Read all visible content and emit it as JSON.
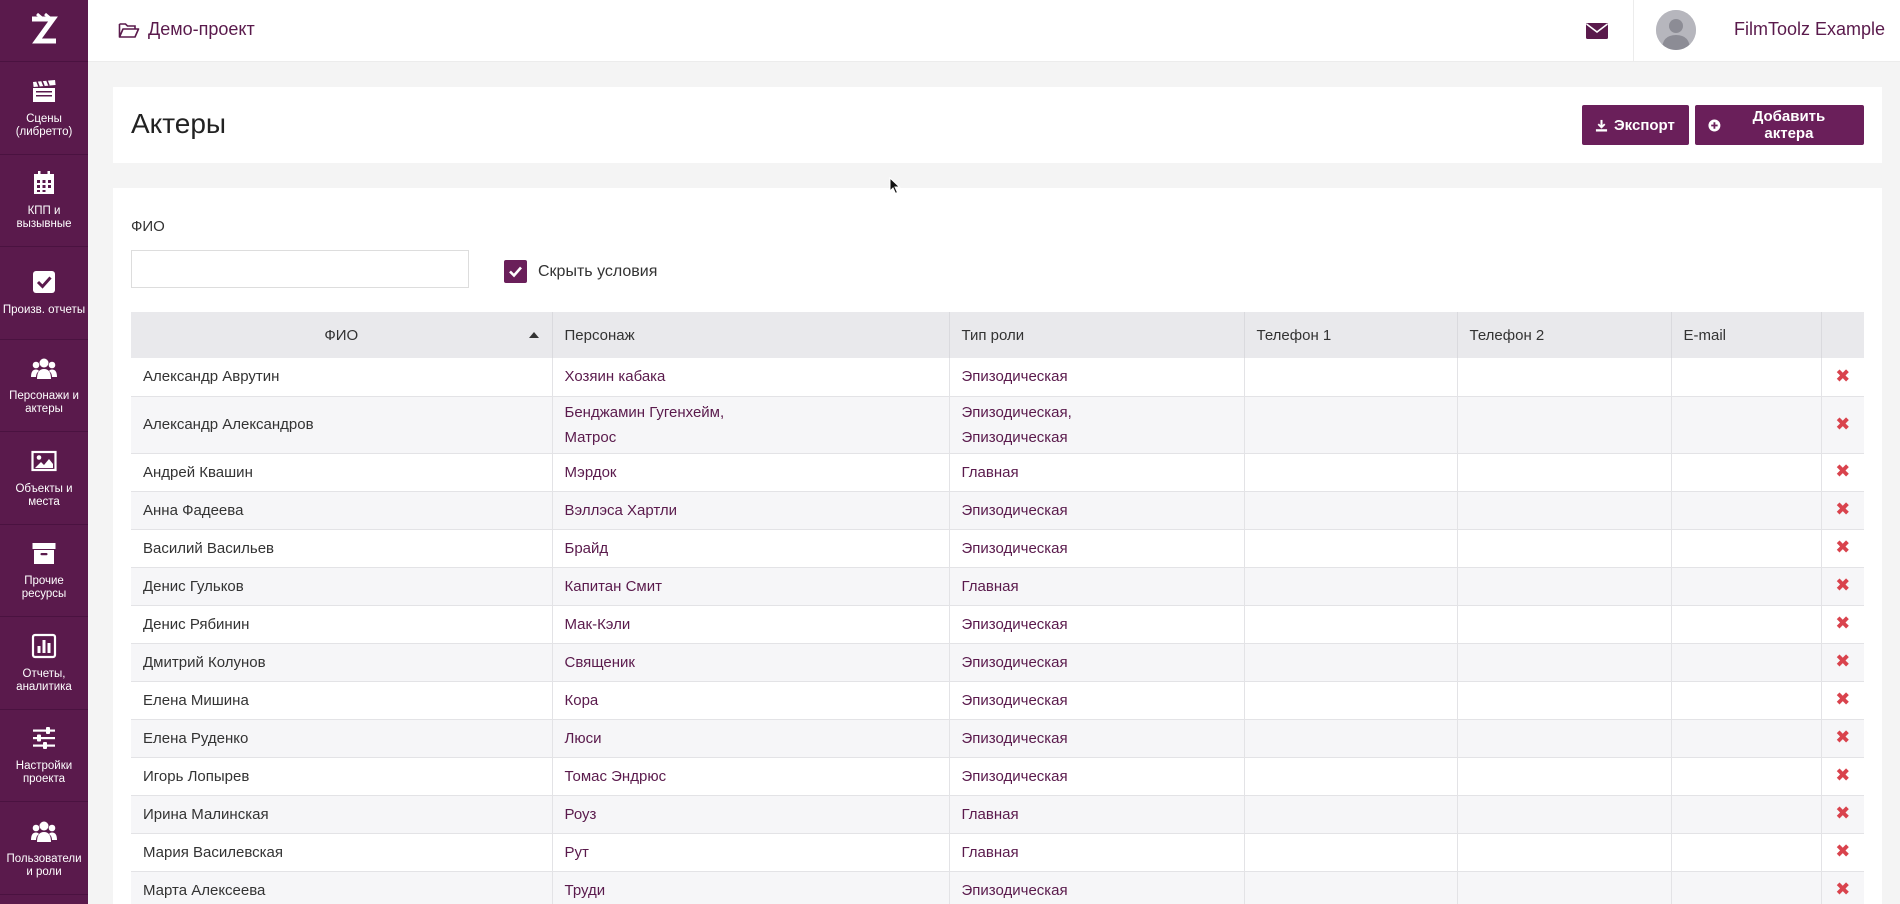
{
  "sidebar": {
    "logo": "Z",
    "items": [
      {
        "label": "Сцены (либретто)",
        "icon": "clapperboard-icon"
      },
      {
        "label": "КПП и вызывные",
        "icon": "calendar-icon"
      },
      {
        "label": "Произв. отчеты",
        "icon": "check-square-icon"
      },
      {
        "label": "Персонажи и актеры",
        "icon": "users-icon"
      },
      {
        "label": "Объекты и места",
        "icon": "image-icon"
      },
      {
        "label": "Прочие ресурсы",
        "icon": "archive-icon"
      },
      {
        "label": "Отчеты, аналитика",
        "icon": "bar-chart-icon"
      },
      {
        "label": "Настройки проекта",
        "icon": "sliders-icon"
      },
      {
        "label": "Пользователи и роли",
        "icon": "users-icon"
      }
    ]
  },
  "topbar": {
    "project": "Демо-проект",
    "user": "FilmToolz Example"
  },
  "header": {
    "title": "Актеры",
    "export_label": "Экспорт",
    "add_label": "Добавить актера"
  },
  "filters": {
    "name_label": "ФИО",
    "name_value": "",
    "hide_conditions_label": "Скрыть условия",
    "hide_conditions_checked": true
  },
  "table": {
    "columns": [
      "ФИО",
      "Персонаж",
      "Тип роли",
      "Телефон 1",
      "Телефон 2",
      "E-mail"
    ],
    "rows": [
      {
        "name": "Александр Аврутин",
        "character": "Хозяин кабака",
        "role": "Эпизодическая",
        "phone1": "",
        "phone2": "",
        "email": ""
      },
      {
        "name": "Александр Александров",
        "character": "Бенджамин Гугенхейм,",
        "character2": "Матрос",
        "role": "Эпизодическая,",
        "role2": "Эпизодическая",
        "phone1": "",
        "phone2": "",
        "email": ""
      },
      {
        "name": "Андрей Квашин",
        "character": "Мэрдок",
        "role": "Главная",
        "phone1": "",
        "phone2": "",
        "email": ""
      },
      {
        "name": "Анна Фадеева",
        "character": "Вэллэса Хартли",
        "role": "Эпизодическая",
        "phone1": "",
        "phone2": "",
        "email": ""
      },
      {
        "name": "Василий Васильев",
        "character": "Брайд",
        "role": "Эпизодическая",
        "phone1": "",
        "phone2": "",
        "email": ""
      },
      {
        "name": "Денис Гульков",
        "character": "Капитан Смит",
        "role": "Главная",
        "phone1": "",
        "phone2": "",
        "email": ""
      },
      {
        "name": "Денис Рябинин",
        "character": "Мак-Кэли",
        "role": "Эпизодическая",
        "phone1": "",
        "phone2": "",
        "email": ""
      },
      {
        "name": "Дмитрий Колунов",
        "character": "Священик",
        "role": "Эпизодическая",
        "phone1": "",
        "phone2": "",
        "email": ""
      },
      {
        "name": "Елена Мишина",
        "character": "Кора",
        "role": "Эпизодическая",
        "phone1": "",
        "phone2": "",
        "email": ""
      },
      {
        "name": "Елена Руденко",
        "character": "Люси",
        "role": "Эпизодическая",
        "phone1": "",
        "phone2": "",
        "email": ""
      },
      {
        "name": "Игорь Лопырев",
        "character": "Томас Эндрюс",
        "role": "Эпизодическая",
        "phone1": "",
        "phone2": "",
        "email": ""
      },
      {
        "name": "Ирина Малинская",
        "character": "Роуз",
        "role": "Главная",
        "phone1": "",
        "phone2": "",
        "email": ""
      },
      {
        "name": "Мария Василевская",
        "character": "Рут",
        "role": "Главная",
        "phone1": "",
        "phone2": "",
        "email": ""
      },
      {
        "name": "Марта Алексеева",
        "character": "Труди",
        "role": "Эпизодическая",
        "phone1": "",
        "phone2": "",
        "email": ""
      }
    ]
  },
  "colors": {
    "brand": "#5a1a4c",
    "button": "#6a1f5a",
    "delete": "#d9434d"
  }
}
